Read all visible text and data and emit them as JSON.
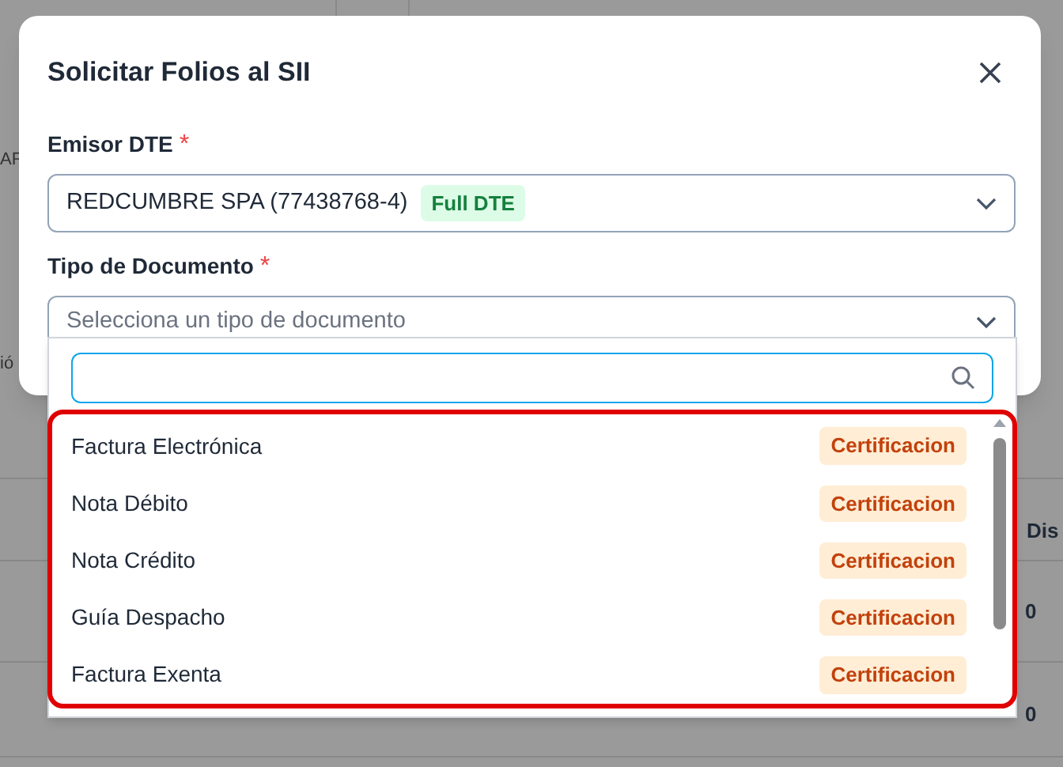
{
  "background": {
    "fragments": [
      {
        "text": "AF",
        "kind": "left"
      },
      {
        "text": "ió",
        "kind": "left"
      },
      {
        "text": "Dis",
        "kind": "header"
      },
      {
        "text": "0",
        "kind": "cell"
      },
      {
        "text": "0",
        "kind": "cell"
      }
    ]
  },
  "dialog": {
    "title": "Solicitar Folios al SII",
    "emisor": {
      "label": "Emisor DTE",
      "required_mark": "*",
      "value": "REDCUMBRE SPA (77438768-4)",
      "badge": "Full DTE"
    },
    "tipo": {
      "label": "Tipo de Documento",
      "required_mark": "*",
      "placeholder": "Selecciona un tipo de documento",
      "expanded": true
    }
  },
  "dropdown": {
    "options": [
      {
        "label": "Factura Electrónica",
        "badge": "Certificacion"
      },
      {
        "label": "Nota Débito",
        "badge": "Certificacion"
      },
      {
        "label": "Nota Crédito",
        "badge": "Certificacion"
      },
      {
        "label": "Guía Despacho",
        "badge": "Certificacion"
      },
      {
        "label": "Factura Exenta",
        "badge": "Certificacion"
      }
    ]
  }
}
